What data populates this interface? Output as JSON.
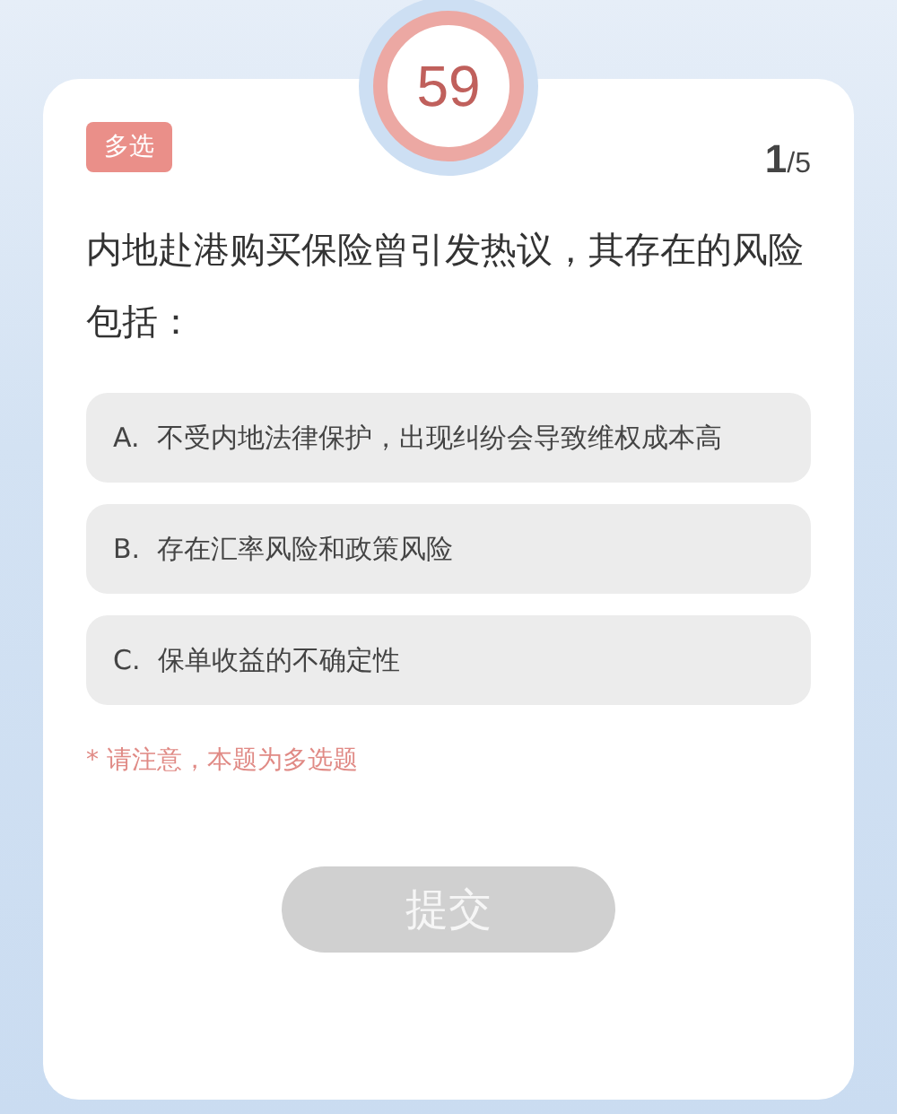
{
  "timer": {
    "value": "59"
  },
  "question": {
    "type_badge": "多选",
    "current": "1",
    "total": "/5",
    "text": "内地赴港购买保险曾引发热议，其存在的风险包括："
  },
  "options": [
    {
      "label": "A.  不受内地法律保护，出现纠纷会导致维权成本高",
      "selected": false
    },
    {
      "label": "B.  存在汇率风险和政策风险",
      "selected": false
    },
    {
      "label": "C.  保单收益的不确定性",
      "selected": false
    }
  ],
  "note": "* 请注意，本题为多选题",
  "submit": {
    "label": "提交",
    "disabled": true
  }
}
